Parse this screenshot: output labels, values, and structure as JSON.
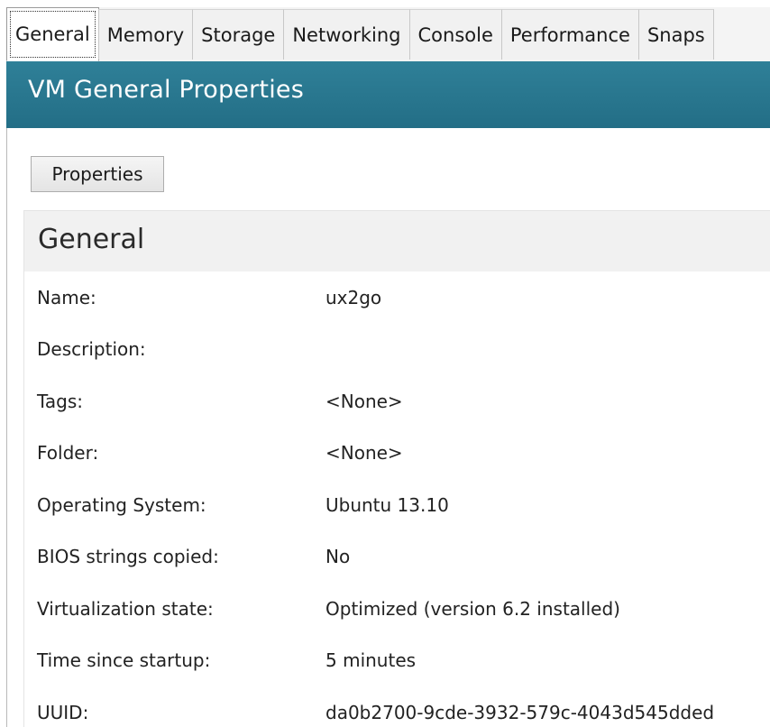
{
  "tabs": [
    {
      "label": "General",
      "active": true
    },
    {
      "label": "Memory",
      "active": false
    },
    {
      "label": "Storage",
      "active": false
    },
    {
      "label": "Networking",
      "active": false
    },
    {
      "label": "Console",
      "active": false
    },
    {
      "label": "Performance",
      "active": false
    },
    {
      "label": "Snaps",
      "active": false
    }
  ],
  "header": {
    "title": "VM General Properties"
  },
  "toolbar": {
    "properties_label": "Properties"
  },
  "section": {
    "title": "General",
    "rows": [
      {
        "label": "Name:",
        "value": "ux2go"
      },
      {
        "label": "Description:",
        "value": ""
      },
      {
        "label": "Tags:",
        "value": "<None>"
      },
      {
        "label": "Folder:",
        "value": "<None>"
      },
      {
        "label": "Operating System:",
        "value": "Ubuntu 13.10"
      },
      {
        "label": "BIOS strings copied:",
        "value": "No"
      },
      {
        "label": "Virtualization state:",
        "value": "Optimized (version 6.2 installed)"
      },
      {
        "label": "Time since startup:",
        "value": "5 minutes"
      },
      {
        "label": "UUID:",
        "value": "da0b2700-9cde-3932-579c-4043d545dded"
      }
    ]
  },
  "colors": {
    "header_bg": "#2a7890",
    "header_text": "#ffffff",
    "section_header_bg": "#f1f1f1"
  }
}
